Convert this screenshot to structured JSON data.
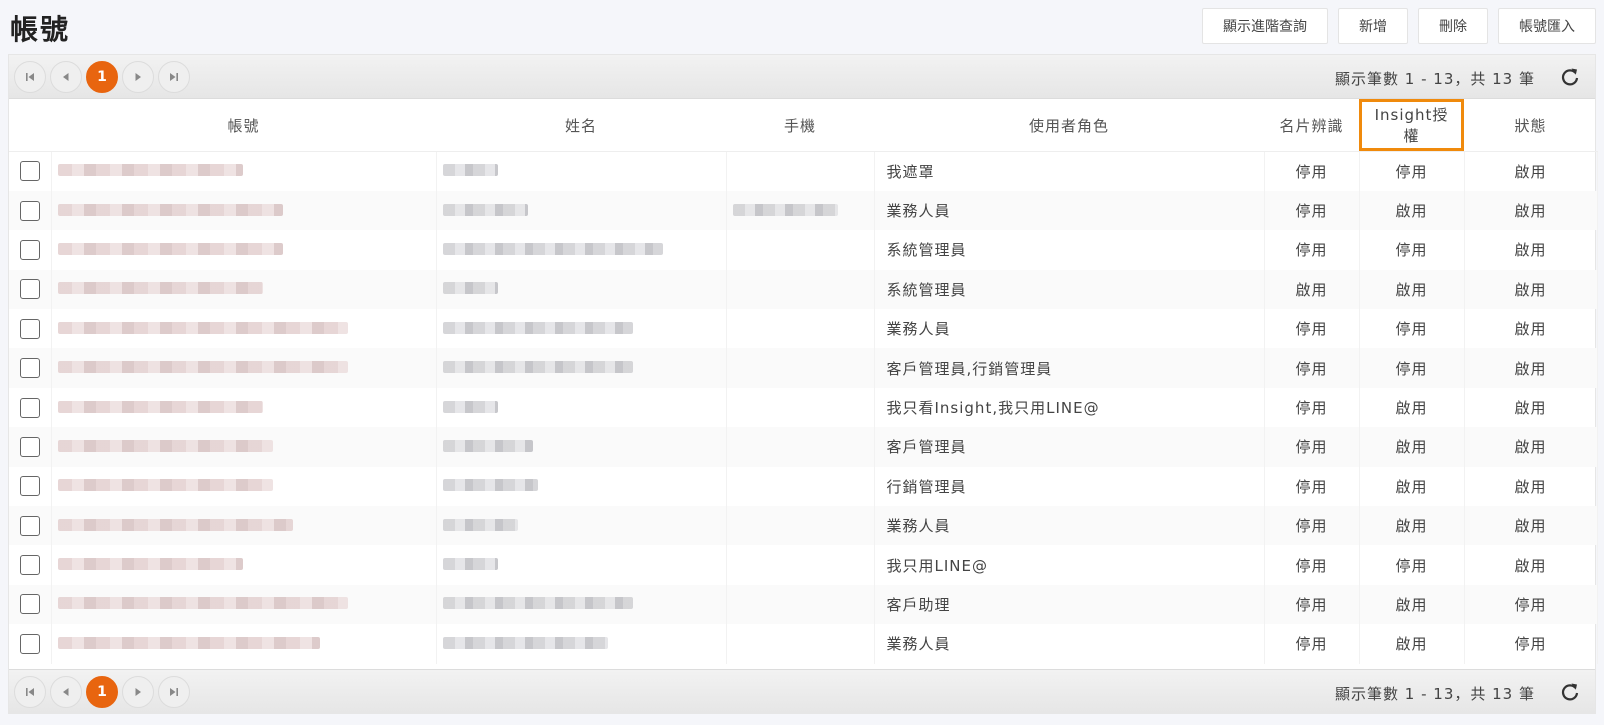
{
  "page": {
    "title": "帳號"
  },
  "actions": {
    "advanced_search": "顯示進階查詢",
    "add": "新增",
    "delete": "刪除",
    "import": "帳號匯入"
  },
  "pager": {
    "current_page": "1",
    "info": "顯示筆數 1 - 13，共 13 筆"
  },
  "columns": {
    "account": "帳號",
    "name": "姓名",
    "mobile": "手機",
    "role": "使用者角色",
    "card_recognition": "名片辨識",
    "insight": "Insight授權",
    "status": "狀態"
  },
  "rows": [
    {
      "role": "我遮罩",
      "card": "停用",
      "insight": "停用",
      "status": "啟用"
    },
    {
      "role": "業務人員",
      "card": "停用",
      "insight": "啟用",
      "status": "啟用"
    },
    {
      "role": "系統管理員",
      "card": "停用",
      "insight": "停用",
      "status": "啟用"
    },
    {
      "role": "系統管理員",
      "card": "啟用",
      "insight": "啟用",
      "status": "啟用"
    },
    {
      "role": "業務人員",
      "card": "停用",
      "insight": "停用",
      "status": "啟用"
    },
    {
      "role": "客戶管理員,行銷管理員",
      "card": "停用",
      "insight": "停用",
      "status": "啟用"
    },
    {
      "role": "我只看Insight,我只用LINE@",
      "card": "停用",
      "insight": "啟用",
      "status": "啟用"
    },
    {
      "role": "客戶管理員",
      "card": "停用",
      "insight": "啟用",
      "status": "啟用"
    },
    {
      "role": "行銷管理員",
      "card": "停用",
      "insight": "啟用",
      "status": "啟用"
    },
    {
      "role": "業務人員",
      "card": "停用",
      "insight": "啟用",
      "status": "啟用"
    },
    {
      "role": "我只用LINE@",
      "card": "停用",
      "insight": "停用",
      "status": "啟用"
    },
    {
      "role": "客戶助理",
      "card": "停用",
      "insight": "啟用",
      "status": "停用"
    },
    {
      "role": "業務人員",
      "card": "停用",
      "insight": "啟用",
      "status": "停用"
    }
  ],
  "icons": {
    "first": "first-page-icon",
    "prev": "prev-page-icon",
    "next": "next-page-icon",
    "last": "last-page-icon",
    "refresh": "refresh-icon"
  },
  "colors": {
    "accent": "#e8650f",
    "highlight": "#f08a0c"
  }
}
